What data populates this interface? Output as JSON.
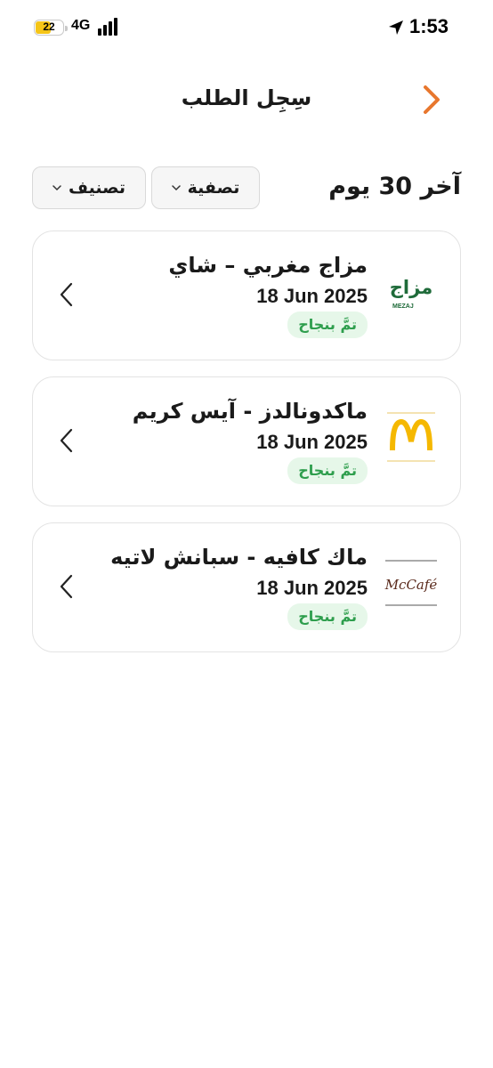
{
  "status_bar": {
    "battery": "22",
    "network": "4G",
    "time": "1:53"
  },
  "header": {
    "title": "سِجِل الطلب",
    "back_icon": "chevron-right-icon"
  },
  "filters": {
    "period_title": "آخر 30 يوم",
    "filter_label": "تصفية",
    "sort_label": "تصنيف"
  },
  "orders": [
    {
      "name": "مزاج مغربي – شاي",
      "date": "18 Jun 2025",
      "status": "تمَّ بنجاح",
      "logo": "mezaj-logo",
      "logo_text": "مزاج",
      "logo_subtext": "MEZAJ"
    },
    {
      "name": "ماكدونالدز - آيس كريم",
      "date": "18 Jun 2025",
      "status": "تمَّ بنجاح",
      "logo": "mcdonalds-logo"
    },
    {
      "name": "ماك كافيه - سبانش لاتيه",
      "date": "18 Jun 2025",
      "status": "تمَّ بنجاح",
      "logo": "mccafe-logo",
      "logo_text": "McCafé"
    }
  ],
  "colors": {
    "accent": "#e8772e",
    "status_bg": "#e6f7e9",
    "status_text": "#2e9e4d",
    "mezaj_green": "#1f6b3a",
    "mcd_yellow": "#f5b800",
    "mccafe_brown": "#5a2a1c"
  }
}
